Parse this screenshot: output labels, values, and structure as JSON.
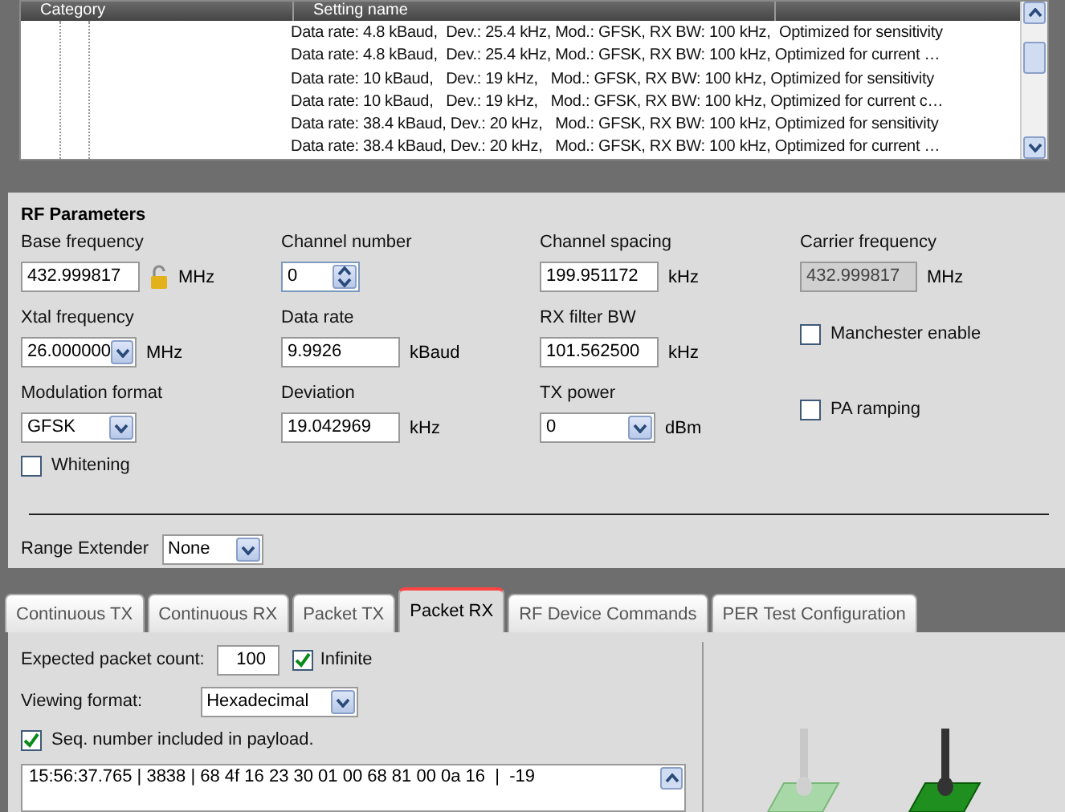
{
  "table": {
    "columns": [
      "Category",
      "Setting name"
    ],
    "rows": [
      "Data rate: 4.8 kBaud,  Dev.: 25.4 kHz, Mod.: GFSK, RX BW: 100 kHz,  Optimized for sensitivity",
      "Data rate: 4.8 kBaud,  Dev.: 25.4 kHz, Mod.: GFSK, RX BW: 100 kHz, Optimized for current …",
      "Data rate: 10 kBaud,   Dev.: 19 kHz,   Mod.: GFSK, RX BW: 100 kHz, Optimized for sensitivity",
      "Data rate: 10 kBaud,   Dev.: 19 kHz,   Mod.: GFSK, RX BW: 100 kHz, Optimized for current c…",
      "Data rate: 38.4 kBaud, Dev.: 20 kHz,   Mod.: GFSK, RX BW: 100 kHz, Optimized for sensitivity",
      "Data rate: 38.4 kBaud, Dev.: 20 kHz,   Mod.: GFSK, RX BW: 100 kHz, Optimized for current …"
    ]
  },
  "rf_parameters": {
    "title": "RF Parameters",
    "fields": [
      {
        "kind": "input",
        "label": "Base frequency",
        "value": "432.999817",
        "unit": "MHz",
        "locked": false
      },
      {
        "kind": "spinner",
        "label": "Channel number",
        "value": "0"
      },
      {
        "kind": "input",
        "label": "Channel spacing",
        "value": "199.951172",
        "unit": "kHz"
      },
      {
        "kind": "readonly",
        "label": "Carrier frequency",
        "value": "432.999817",
        "unit": "MHz"
      },
      {
        "kind": "dropdown",
        "label": "Xtal frequency",
        "value": "26.000000",
        "unit": "MHz"
      },
      {
        "kind": "input",
        "label": "Data rate",
        "value": "9.9926",
        "unit": "kBaud"
      },
      {
        "kind": "input",
        "label": "RX filter BW",
        "value": "101.562500",
        "unit": "kHz"
      },
      {
        "kind": "checkbox",
        "label": "Manchester enable",
        "checked": false
      },
      {
        "kind": "dropdown",
        "label": "Modulation format",
        "value": "GFSK"
      },
      {
        "kind": "input",
        "label": "Deviation",
        "value": "19.042969",
        "unit": "kHz"
      },
      {
        "kind": "dropdown",
        "label": "TX power",
        "value": "0",
        "unit": "dBm"
      },
      {
        "kind": "checkbox",
        "label": "PA ramping",
        "checked": false
      }
    ],
    "whitening": {
      "label": "Whitening",
      "checked": false
    },
    "range_extender": {
      "label": "Range Extender",
      "value": "None"
    }
  },
  "tabs": [
    {
      "label": "Continuous TX",
      "selected": false
    },
    {
      "label": "Continuous RX",
      "selected": false
    },
    {
      "label": "Packet TX",
      "selected": false
    },
    {
      "label": "Packet RX",
      "selected": true
    },
    {
      "label": "RF Device Commands",
      "selected": false
    },
    {
      "label": "PER Test Configuration",
      "selected": false
    }
  ],
  "packet_rx": {
    "expected_label": "Expected packet count:",
    "expected_value": "100",
    "infinite": {
      "label": "Infinite",
      "checked": true
    },
    "format_label": "Viewing format:",
    "format_value": "Hexadecimal",
    "seq": {
      "label": "Seq. number included in payload.",
      "checked": true
    },
    "log": [
      "15:56:37.765 | 3838 | 68 4f 16 23 30 01 00 68 81 00 0a 16  |  -19"
    ]
  }
}
